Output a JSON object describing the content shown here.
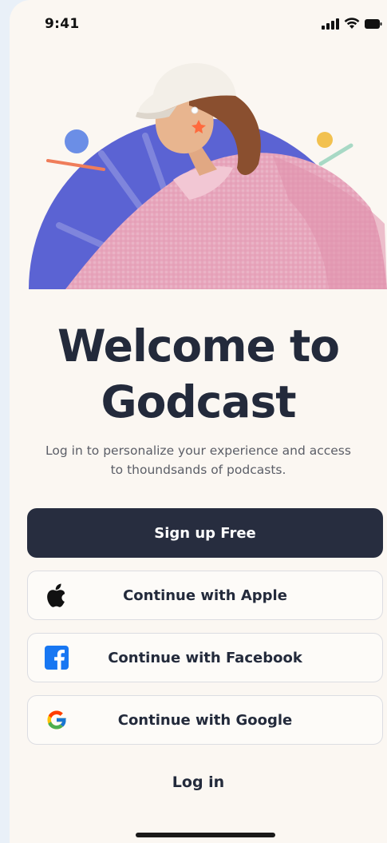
{
  "status_bar": {
    "time": "9:41"
  },
  "hero": {
    "colors": {
      "circle": "#5b63d3",
      "shirt": "#e7a8bd",
      "cap": "#f3efe8"
    }
  },
  "welcome": {
    "title_line1": "Welcome to",
    "title_line2": "Godcast",
    "subtitle_line1": "Log in to personalize your experience and access",
    "subtitle_line2": "to thoundsands of podcasts."
  },
  "buttons": {
    "signup": "Sign up Free",
    "apple": "Continue with Apple",
    "facebook": "Continue with Facebook",
    "google": "Continue with Google"
  },
  "login_label": "Log in",
  "icons": {
    "apple": "apple-icon",
    "facebook": "facebook-icon",
    "google": "google-icon"
  },
  "colors": {
    "primary": "#272d3f",
    "background": "#fbf7f2",
    "facebook": "#1877f2"
  }
}
